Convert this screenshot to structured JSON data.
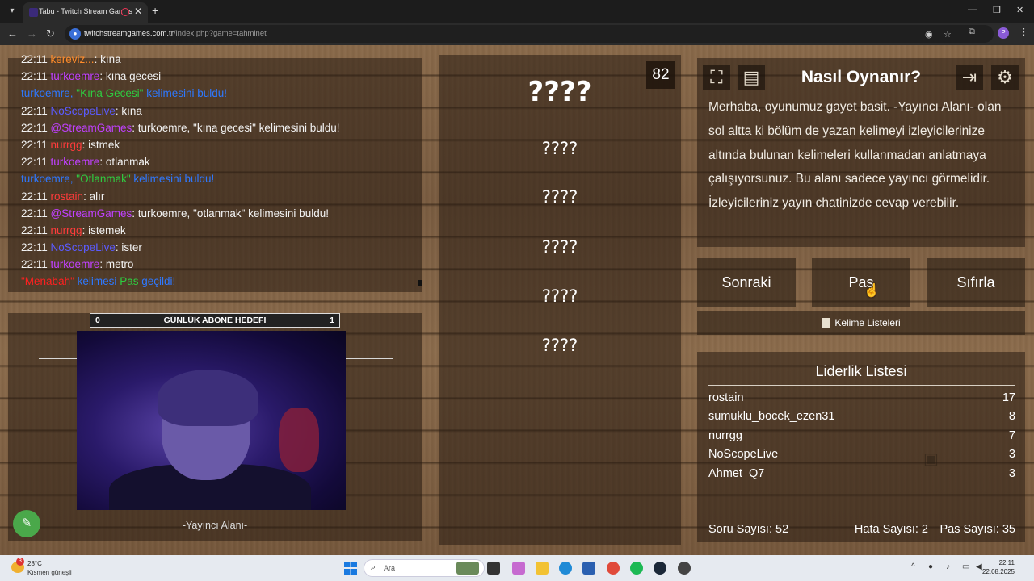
{
  "browser": {
    "tab_title": "Tabu - Twitch Stream Games",
    "url_host": "twitchstreamgames.com.tr",
    "url_path": "/index.php?game=tahminet",
    "profile_initial": "P"
  },
  "chat": {
    "lines": [
      {
        "time": "22:11",
        "user": "kereviz...",
        "msg": ": kına"
      },
      {
        "time": "22:11",
        "user": "turkoemre",
        "msg": ": kına gecesi"
      },
      {
        "sys_user": "turkoemre,",
        "sys_word": "\"Kına Gecesi\"",
        "sys_text": "kelimesini buldu!"
      },
      {
        "time": "22:11",
        "user": "NoScopeLive",
        "msg": ": kına"
      },
      {
        "time": "22:11",
        "user": "@StreamGames",
        "msg": ": turkoemre, \"kına gecesi\" kelimesini buldu!"
      },
      {
        "time": "22:11",
        "user": "nurrgg",
        "msg": ": istmek"
      },
      {
        "time": "22:11",
        "user": "turkoemre",
        "msg": ": otlanmak"
      },
      {
        "sys_user": "turkoemre,",
        "sys_word": "\"Otlanmak\"",
        "sys_text": "kelimesini buldu!"
      },
      {
        "time": "22:11",
        "user": "rostain",
        "msg": ": alır"
      },
      {
        "time": "22:11",
        "user": "@StreamGames",
        "msg": ": turkoemre, \"otlanmak\" kelimesini buldu!"
      },
      {
        "time": "22:11",
        "user": "nurrgg",
        "msg": ": istemek"
      },
      {
        "time": "22:11",
        "user": "NoScopeLive",
        "msg": ": ister"
      },
      {
        "time": "22:11",
        "user": "turkoemre",
        "msg": ": metro"
      },
      {
        "pass_word": "\"Menabah\"",
        "pass_a": "kelimesi",
        "pass_b": "Pas",
        "pass_c": "geçildi!"
      }
    ]
  },
  "streamer": {
    "goal_min": "0",
    "goal_label": "GÜNLÜK ABONE HEDEFI",
    "goal_max": "1",
    "label": "-Yayıncı Alanı-"
  },
  "words": {
    "timer": "82",
    "main": "????",
    "forbidden": [
      "????",
      "????",
      "????",
      "????",
      "????"
    ]
  },
  "info": {
    "title": "Nasıl Oynanır?",
    "text": "Merhaba, oyunumuz gayet basit. -Yayıncı Alanı- olan sol altta ki bölüm de yazan kelimeyi izleyicilerinize altında bulunan kelimeleri kullanmadan anlatmaya çalışıyorsunuz. Bu alanı sadece yayıncı görmelidir. İzleyicileriniz yayın chatinizde cevap verebilir."
  },
  "buttons": {
    "next": "Sonraki",
    "pass": "Pas",
    "reset": "Sıfırla",
    "word_lists": "Kelime Listeleri"
  },
  "leaderboard": {
    "title": "Liderlik Listesi",
    "rows": [
      {
        "name": "rostain",
        "score": "17"
      },
      {
        "name": "sumuklu_bocek_ezen31",
        "score": "8"
      },
      {
        "name": "nurrgg",
        "score": "7"
      },
      {
        "name": "NoScopeLive",
        "score": "3"
      },
      {
        "name": "Ahmet_Q7",
        "score": "3"
      }
    ],
    "questions": "Soru Sayısı: 52",
    "errors": "Hata Sayısı: 2",
    "passes": "Pas Sayısı: 35"
  },
  "taskbar": {
    "temp": "28°C",
    "weather": "Kısmen güneşli",
    "weather_badge": "3",
    "search_placeholder": "Ara",
    "time": "22:11",
    "date": "22.08.2025"
  },
  "colors": {
    "user_purple": "#c040ff",
    "user_blue": "#5b5bff",
    "user_red": "#ff3b3b",
    "system_blue": "#2e78ff",
    "system_green": "#2ecc40",
    "accent_green": "#4aa84a"
  }
}
